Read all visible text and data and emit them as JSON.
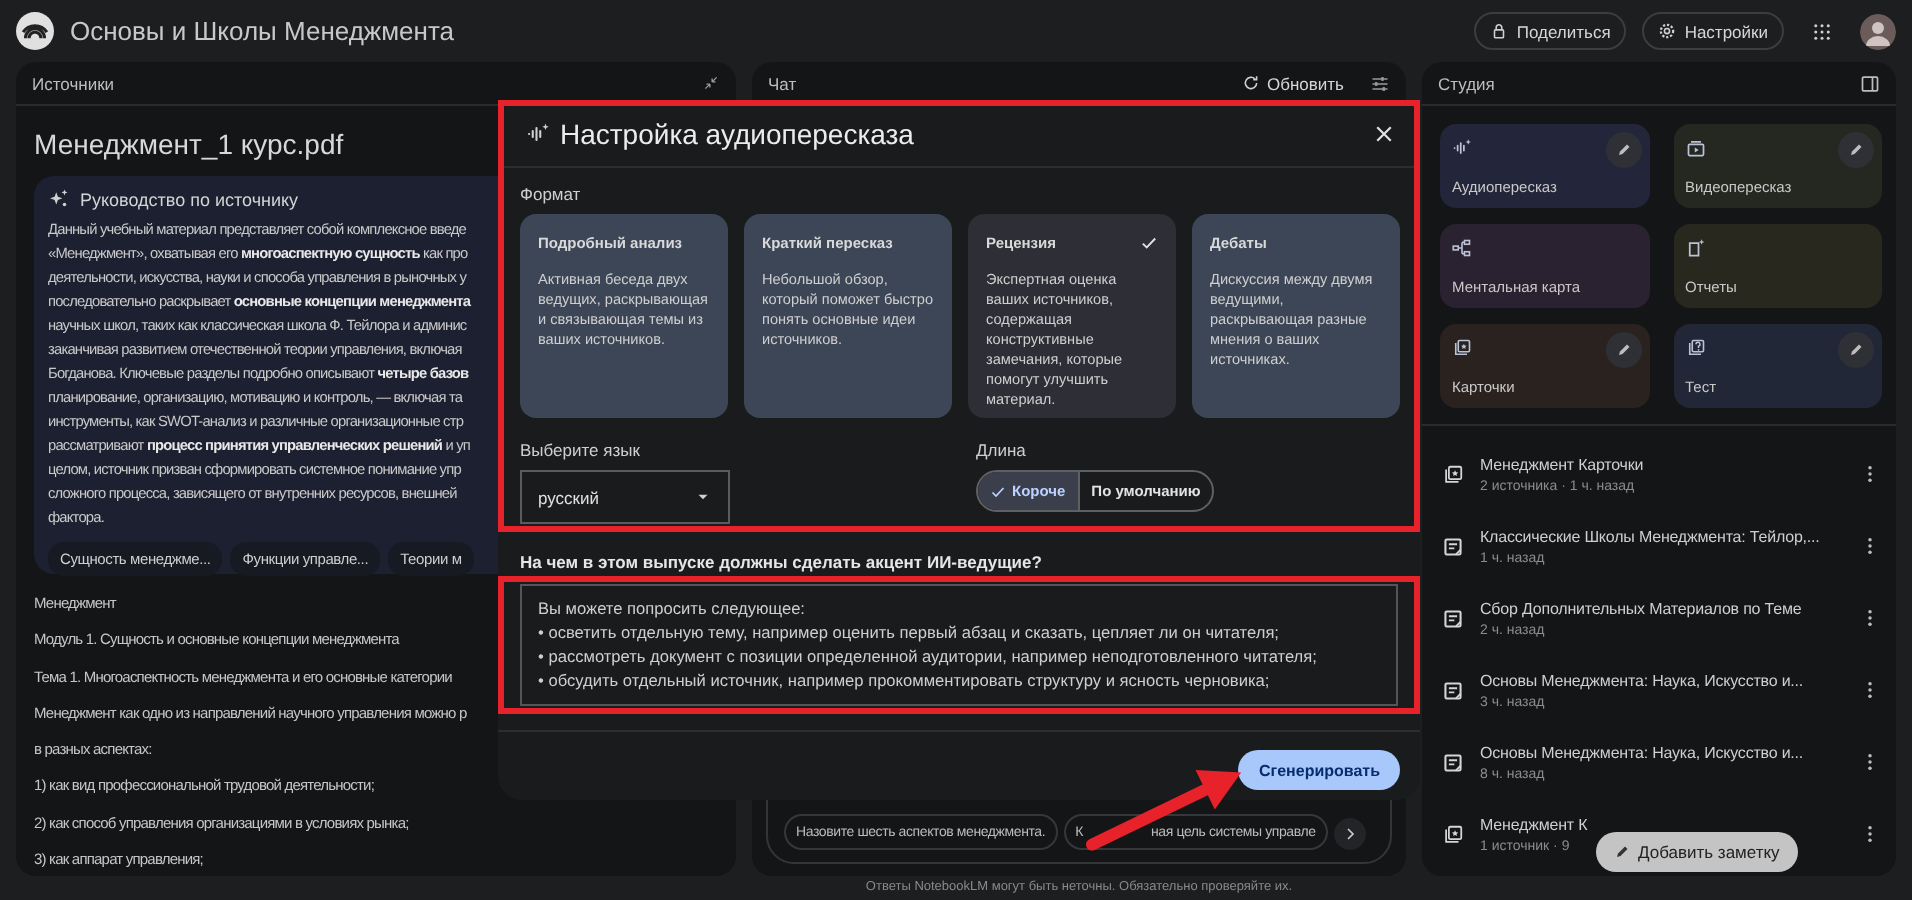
{
  "app": {
    "title": "Основы и Школы Менеджмента"
  },
  "top_actions": [
    {
      "kind": "share",
      "label": "Поделиться"
    },
    {
      "kind": "settings",
      "label": "Настройки"
    }
  ],
  "sources": {
    "title": "Источники",
    "document": "Менеджмент_1 курс.pdf",
    "guide": {
      "title": "Руководство по источнику",
      "lines": [
        "Данный учебный материал представляет собой комплексное введе",
        "«Менеджмент», охватывая его **многоаспектную сущность** как про",
        "деятельности, искусства, науки и способа управления в рыночных у",
        "последовательно раскрывает **основные концепции менеджмента**",
        "научных школ, таких как классическая школа Ф. Тейлора и админис",
        "заканчивая развитием отечественной теории управления, включая",
        "Богданова. Ключевые разделы подробно описывают **четыре базов**",
        "планирование, организацию, мотивацию и контроль, — включая та",
        "инструменты, как SWOT-анализ и различные организационные стр",
        "рассматривают **процесс принятия управленческих решений** и уп",
        "целом, источник призван сформировать системное понимание упр",
        "сложного процесса, зависящего от внутренних ресурсов, внешней",
        "фактора."
      ]
    },
    "topics": [
      "Сущность менеджме...",
      "Функции управле...",
      "Теории м"
    ],
    "content": [
      "Менеджмент",
      "Модуль 1. Сущность и основные концепции менеджмента",
      "Тема 1. Многоаспектность менеджмента и его основные категории",
      "Менеджмент как одно из направлений научного управления можно р",
      "в разных аспектах:",
      "1) как вид профессиональной трудовой деятельности;",
      "2) как способ управления организациями в условиях рынка;",
      "3) как аппарат управления;"
    ]
  },
  "chat": {
    "title": "Чат",
    "refresh": "Обновить",
    "suggestions": [
      {
        "parts": [
          "Назовите шесть аспектов менеджмента."
        ]
      },
      {
        "parts": [
          "К",
          "ная цель системы управле"
        ]
      }
    ],
    "footer": "Ответы NotebookLM могут быть неточны. Обязательно проверяйте их."
  },
  "studio": {
    "title": "Студия",
    "tiles": [
      {
        "kind": "audio",
        "label": "Аудиопересказ",
        "editable": true,
        "color": "#23263a"
      },
      {
        "kind": "video",
        "label": "Видеопересказ",
        "editable": true,
        "color": "#242820"
      },
      {
        "kind": "mindmap",
        "label": "Ментальная карта",
        "editable": false,
        "color": "#2a2230"
      },
      {
        "kind": "report",
        "label": "Отчеты",
        "editable": false,
        "color": "#29281e"
      },
      {
        "kind": "flashcards",
        "label": "Карточки",
        "editable": true,
        "color": "#2a221f"
      },
      {
        "kind": "quiz",
        "label": "Тест",
        "editable": true,
        "color": "#222737"
      }
    ],
    "notes": [
      {
        "kind": "flashcards",
        "title": "Менеджмент Карточки",
        "meta": "2 источника · 1 ч. назад"
      },
      {
        "kind": "note",
        "title": "Классические Школы Менеджмента: Тейлор,...",
        "meta": "1 ч. назад"
      },
      {
        "kind": "note",
        "title": "Сбор Дополнительных Материалов по Теме",
        "meta": "2 ч. назад"
      },
      {
        "kind": "note",
        "title": "Основы Менеджмента: Наука, Искусство и...",
        "meta": "3 ч. назад"
      },
      {
        "kind": "note",
        "title": "Основы Менеджмента: Наука, Искусство и...",
        "meta": "8 ч. назад"
      },
      {
        "kind": "flashcards",
        "title": "Менеджмент К",
        "meta": "1 источник · 9"
      }
    ],
    "add_note": "Добавить заметку"
  },
  "dialog": {
    "title": "Настройка аудиопересказа",
    "highlighted": true,
    "format_label": "Формат",
    "formats": [
      {
        "title": "Подробный анализ",
        "description": "Активная беседа двух ведущих, раскрывающая и связывающая темы из ваших источников.",
        "selected": false
      },
      {
        "title": "Краткий пересказ",
        "description": "Небольшой обзор, который поможет быстро понять основные идеи источников.",
        "selected": false
      },
      {
        "title": "Рецензия",
        "description": "Экспертная оценка ваших источников, содержащая конструктивные замечания, которые помогут улучшить материал.",
        "selected": true
      },
      {
        "title": "Дебаты",
        "description": "Дискуссия между двумя ведущими, раскрывающая разные мнения о ваших источниках.",
        "selected": false
      }
    ],
    "language_label": "Выберите язык",
    "language": "русский",
    "length_label": "Длина",
    "lengths": [
      {
        "label": "Короче",
        "selected": true
      },
      {
        "label": "По умолчанию",
        "selected": false
      }
    ],
    "focus": {
      "label": "На чем в этом выпуске должны сделать акцент ИИ-ведущие?",
      "highlighted": true,
      "placeholder": [
        "Вы можете попросить следующее:",
        "• осветить отдельную тему, например оценить первый абзац и сказать, цепляет ли он читателя;",
        "• рассмотреть документ с позиции определенной аудитории, например неподготовленного читателя;",
        "• обсудить отдельный источник, например прокомментировать структуру и ясность черновика;"
      ]
    },
    "generate": {
      "label": "Сгенерировать",
      "pointed_at": true
    }
  }
}
